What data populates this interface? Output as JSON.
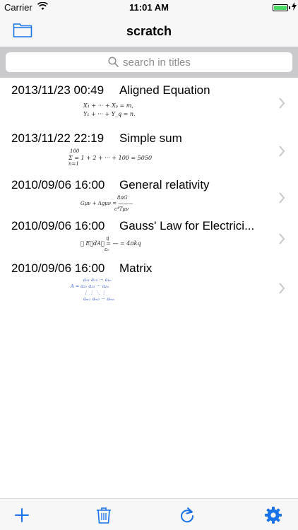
{
  "status": {
    "carrier": "Carrier",
    "time": "11:01 AM"
  },
  "nav": {
    "title": "scratch"
  },
  "search": {
    "placeholder": "search in titles"
  },
  "items": [
    {
      "date": "2013/11/23 00:49",
      "title": "Aligned Equation",
      "formula_lines": [
        "X₁ + ··· + Xₚ = m,",
        "Y₁ + ··· + Y_q = n."
      ]
    },
    {
      "date": "2013/11/22 22:19",
      "title": "Simple sum",
      "formula_lines": [
        "100",
        "Σ  = 1 + 2 + ··· + 100 = 5050",
        "n=1"
      ]
    },
    {
      "date": "2010/09/06 16:00",
      "title": "General relativity",
      "formula_lines": [
        "8πG",
        "Gμν + Λgμν = ———",
        "c⁴Tμν"
      ]
    },
    {
      "date": "2010/09/06 16:00",
      "title": "Gauss' Law for Electrici...",
      "formula_lines": [
        "q",
        "∮ E⃗dA⃗ = — = 4πkq",
        "ε₀"
      ]
    },
    {
      "date": "2010/09/06 16:00",
      "title": "Matrix",
      "formula_lines": [
        "a₁₁  a₁₂  ···  a₁ₙ",
        "A =  a₂₁  a₂₂  ···  a₂ₙ",
        "⋮     ⋮    ⋱    ⋮",
        "aₘ₁  aₘ₂  ···  aₘₙ"
      ]
    }
  ],
  "colors": {
    "accent": "#1a73e8",
    "battery": "#4cd964"
  }
}
